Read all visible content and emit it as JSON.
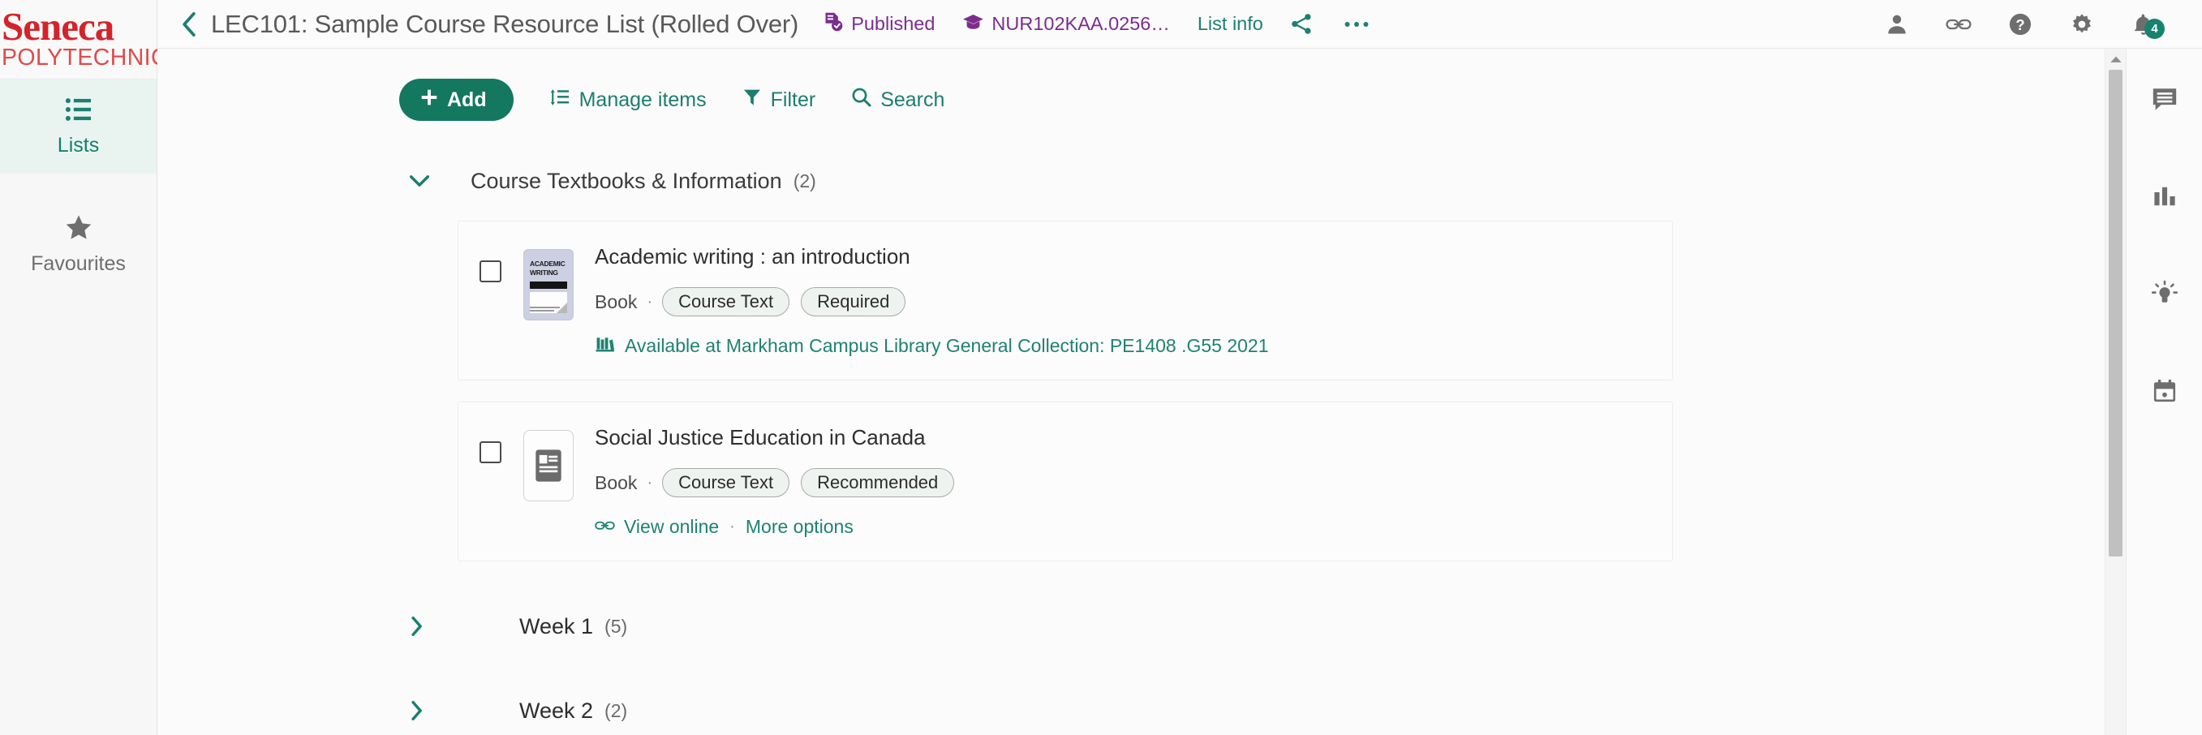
{
  "brand": {
    "line1": "Seneca",
    "line2": "POLYTECHNIC",
    "color": "#d5232a"
  },
  "sidebar": {
    "items": [
      {
        "label": "Lists",
        "icon": "list-icon",
        "active": true
      },
      {
        "label": "Favourites",
        "icon": "star-icon",
        "active": false
      }
    ]
  },
  "header": {
    "back_icon": "chevron-left-icon",
    "title": "LEC101: Sample Course Resource List (Rolled Over)",
    "status": {
      "label": "Published",
      "icon": "document-check-icon",
      "color": "#7b2d8e"
    },
    "course": {
      "label": "NUR102KAA.0256…",
      "icon": "graduation-cap-icon",
      "color": "#7b2d8e"
    },
    "list_info": "List info",
    "share_icon": "share-icon",
    "more_icon": "more-horizontal-icon",
    "right_icons": [
      {
        "name": "user-icon"
      },
      {
        "name": "link-icon"
      },
      {
        "name": "help-icon"
      },
      {
        "name": "gear-icon"
      },
      {
        "name": "bell-icon",
        "badge": "4"
      }
    ],
    "accent_teal": "#1d7f72"
  },
  "toolbar": {
    "add_label": "Add",
    "manage_label": "Manage items",
    "filter_label": "Filter",
    "search_label": "Search",
    "add_color": "#13785f"
  },
  "sections": [
    {
      "title": "Course Textbooks & Information",
      "count": "(2)",
      "expanded": true,
      "items": [
        {
          "title": "Academic writing : an introduction",
          "type": "Book",
          "separator": "·",
          "tags": [
            "Course Text",
            "Required"
          ],
          "availability": {
            "icon": "library-books-icon",
            "text": "Available at Markham Campus Library General Collection: PE1408 .G55 2021"
          },
          "thumb": {
            "kind": "book-cover",
            "cover_text": "ACADEMIC WRITING"
          }
        },
        {
          "title": "Social Justice Education in Canada",
          "type": "Book",
          "separator": "·",
          "tags": [
            "Course Text",
            "Recommended"
          ],
          "links": [
            {
              "icon": "link-icon",
              "label": "View online"
            },
            {
              "icon": "",
              "label": "More options"
            }
          ],
          "link_separator": "·",
          "thumb": {
            "kind": "document-placeholder"
          }
        }
      ]
    }
  ],
  "collapsed_sections": [
    {
      "title": "Week 1",
      "count": "(5)"
    },
    {
      "title": "Week 2",
      "count": "(2)"
    }
  ],
  "right_rail": [
    {
      "name": "comment-icon"
    },
    {
      "name": "bar-chart-icon"
    },
    {
      "name": "lightbulb-icon"
    },
    {
      "name": "calendar-icon"
    }
  ],
  "scrollbar": {
    "up_icon": "triangle-up-icon"
  }
}
